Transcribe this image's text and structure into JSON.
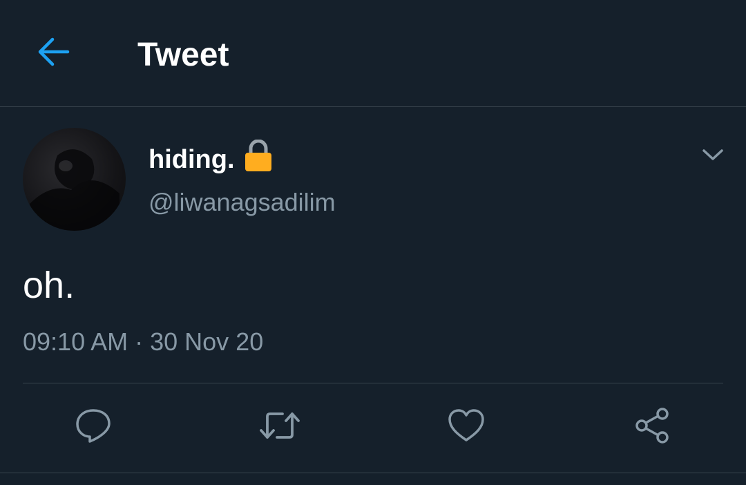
{
  "header": {
    "title": "Tweet",
    "back_icon": "arrow-left-icon"
  },
  "tweet": {
    "display_name": "hiding.",
    "protected_icon": "lock-icon",
    "username": "@liwanagsadilim",
    "text": "oh.",
    "time": "09:10 AM",
    "separator": "·",
    "date": "30 Nov 20"
  },
  "actions": [
    {
      "name": "reply",
      "icon": "reply-icon"
    },
    {
      "name": "retweet",
      "icon": "retweet-icon"
    },
    {
      "name": "like",
      "icon": "heart-icon"
    },
    {
      "name": "share",
      "icon": "share-icon"
    }
  ],
  "colors": {
    "background": "#15202b",
    "accent": "#1da1f2",
    "secondary_text": "#8899a6",
    "divider": "#38444d",
    "lock": "#ffad1f"
  }
}
